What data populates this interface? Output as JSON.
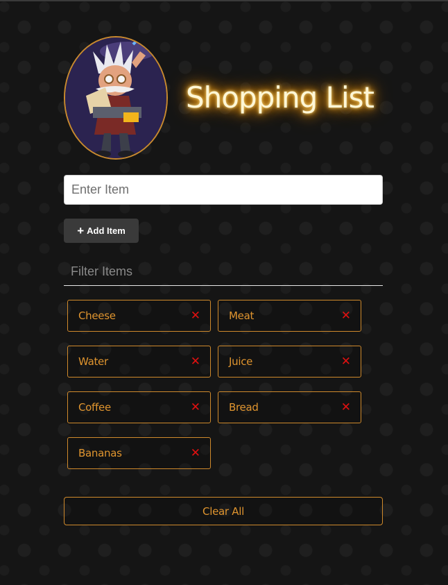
{
  "header": {
    "title": "Shopping List"
  },
  "form": {
    "item_placeholder": "Enter Item",
    "add_button_label": "Add Item",
    "add_button_icon": "plus-icon"
  },
  "filter": {
    "placeholder": "Filter Items"
  },
  "items": [
    {
      "label": "Cheese"
    },
    {
      "label": "Meat"
    },
    {
      "label": "Water"
    },
    {
      "label": "Juice"
    },
    {
      "label": "Coffee"
    },
    {
      "label": "Bread"
    },
    {
      "label": "Bananas"
    }
  ],
  "clear_button_label": "Clear All",
  "colors": {
    "background": "#151515",
    "accent": "#e0952f",
    "border_accent": "#d08a2c",
    "remove": "#e01010",
    "title_glow": "#ff9a00",
    "button_dark": "#3a3a3a"
  }
}
